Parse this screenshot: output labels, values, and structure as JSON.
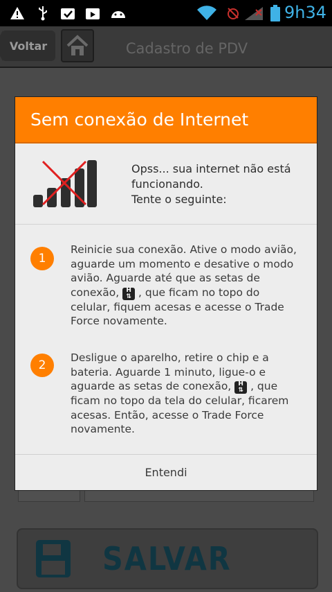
{
  "status_bar": {
    "time": "9h34",
    "icons": [
      "warning-icon",
      "usb-icon",
      "clipboard-check-icon",
      "clipboard-icon",
      "android-icon",
      "wifi-icon",
      "alarm-icon",
      "signal-icon",
      "battery-icon"
    ],
    "time_color": "#3fb2e6"
  },
  "action_bar": {
    "back_label": "Voltar",
    "title": "Cadastro de PDV"
  },
  "background": {
    "save_label": "SALVAR"
  },
  "dialog": {
    "title": "Sem conexão de Internet",
    "accent_color": "#ff7f00",
    "intro": "Opss... sua internet não está funcionando.\nTente o seguinte:",
    "steps": [
      {
        "number": "1",
        "text_before": "Reinicie sua conexão. Ative o modo avião, aguarde um momento e desative o modo avião. Aguarde até que as setas de conexão, ",
        "text_after": " , que ficam no topo do celular, fiquem acesas e acesse o Trade Force novamente."
      },
      {
        "number": "2",
        "text_before": "Desligue o aparelho, retire o chip e a bateria. Aguarde 1 minuto, ligue-o e aguarde as setas de conexão, ",
        "text_after": " , que ficam no topo da tela do celular, ficarem acesas. Então, acesse o Trade Force novamente."
      }
    ],
    "confirm_label": "Entendi"
  }
}
